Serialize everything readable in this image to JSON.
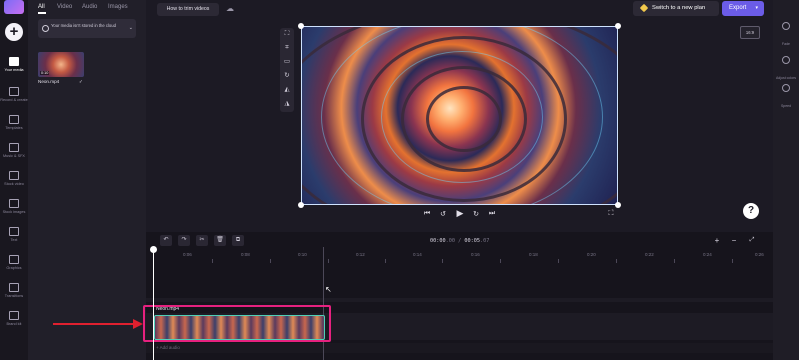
{
  "rail": {
    "items": [
      {
        "label": "Your media",
        "active": true
      },
      {
        "label": "Record & create"
      },
      {
        "label": "Templates"
      },
      {
        "label": "Music & SFX"
      },
      {
        "label": "Stock video"
      },
      {
        "label": "Stock images"
      },
      {
        "label": "Text"
      },
      {
        "label": "Graphics"
      },
      {
        "label": "Transitions"
      },
      {
        "label": "Brand kit"
      }
    ]
  },
  "media": {
    "tabs": [
      "All",
      "Video",
      "Audio",
      "Images"
    ],
    "notice": "Your media isn't stored in the cloud",
    "file_name": "Neon.mp4",
    "duration": "0:10"
  },
  "header": {
    "project_title": "How to trim videos",
    "plan_label": "Switch to a new plan",
    "export_label": "Export"
  },
  "right_rail": {
    "items": [
      "Fade",
      "Adjust colors",
      "Speed"
    ],
    "aspect": "16:9"
  },
  "timeline": {
    "time_current": "00:00",
    "time_current_frac": ".00",
    "time_sep": " / ",
    "time_total": "00:05",
    "time_total_frac": ".07",
    "ticks": [
      "0:06",
      "0:08",
      "0:10",
      "0:12",
      "0:14",
      "0:16",
      "0:18",
      "0:20",
      "0:22",
      "0:24",
      "0:26",
      "0:28"
    ],
    "clip_name": "Neon.mp4",
    "audio_label": "+ Add audio"
  },
  "colors": {
    "accent": "#6b5ce7",
    "highlight": "#e6217f",
    "arrow": "#e0202f"
  }
}
